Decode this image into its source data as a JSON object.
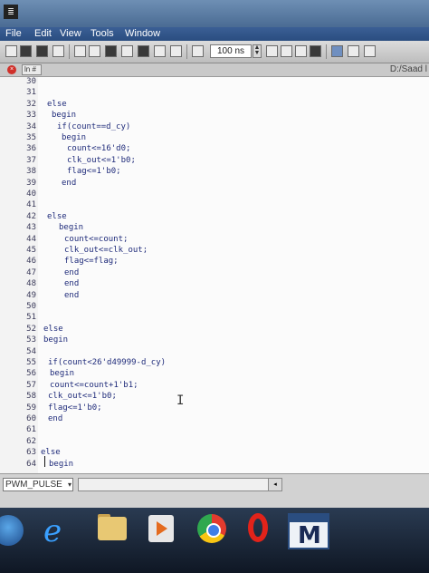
{
  "window": {
    "title_icon_glyph": "≣"
  },
  "menu": [
    {
      "label": "File"
    },
    {
      "label": "Edit"
    },
    {
      "label": "View"
    },
    {
      "label": "Tools"
    },
    {
      "label": "Window"
    }
  ],
  "toolbar": {
    "zoom_value": "100 ns"
  },
  "tab": {
    "label": "ln #"
  },
  "file_path": "D:/Saad l",
  "code": {
    "lines": [
      {
        "n": "30",
        "text": ""
      },
      {
        "n": "31",
        "text": ""
      },
      {
        "n": "32",
        "text": "else"
      },
      {
        "n": "33",
        "text": "begin"
      },
      {
        "n": "34",
        "text": "if(count==d_cy)"
      },
      {
        "n": "35",
        "text": "begin"
      },
      {
        "n": "36",
        "text": "count<=16'd0;"
      },
      {
        "n": "37",
        "text": "clk_out<=1'b0;"
      },
      {
        "n": "38",
        "text": "flag<=1'b0;"
      },
      {
        "n": "39",
        "text": "end"
      },
      {
        "n": "40",
        "text": ""
      },
      {
        "n": "41",
        "text": ""
      },
      {
        "n": "42",
        "text": "else"
      },
      {
        "n": "43",
        "text": "begin"
      },
      {
        "n": "44",
        "text": "count<=count;"
      },
      {
        "n": "45",
        "text": "clk_out<=clk_out;"
      },
      {
        "n": "46",
        "text": "flag<=flag;"
      },
      {
        "n": "47",
        "text": "end"
      },
      {
        "n": "48",
        "text": "end"
      },
      {
        "n": "49",
        "text": "end"
      },
      {
        "n": "50",
        "text": ""
      },
      {
        "n": "51",
        "text": ""
      },
      {
        "n": "52",
        "text": "else"
      },
      {
        "n": "53",
        "text": "begin"
      },
      {
        "n": "54",
        "text": ""
      },
      {
        "n": "55",
        "text": "if(count<26'd49999-d_cy)"
      },
      {
        "n": "56",
        "text": "begin"
      },
      {
        "n": "57",
        "text": "count<=count+1'b1;"
      },
      {
        "n": "58",
        "text": "clk_out<=1'b0;"
      },
      {
        "n": "59",
        "text": "flag<=1'b0;"
      },
      {
        "n": "60",
        "text": "end"
      },
      {
        "n": "61",
        "text": ""
      },
      {
        "n": "62",
        "text": ""
      },
      {
        "n": "63",
        "text": "else"
      },
      {
        "n": "64",
        "text": "begin"
      }
    ]
  },
  "status": {
    "module_value": "PWM_PULSE"
  },
  "taskbar": {
    "items": [
      {
        "name": "windows-start"
      },
      {
        "name": "internet-explorer"
      },
      {
        "name": "file-explorer"
      },
      {
        "name": "media-player"
      },
      {
        "name": "chrome"
      },
      {
        "name": "opera"
      },
      {
        "name": "modelsim",
        "glyph": "M"
      }
    ]
  }
}
